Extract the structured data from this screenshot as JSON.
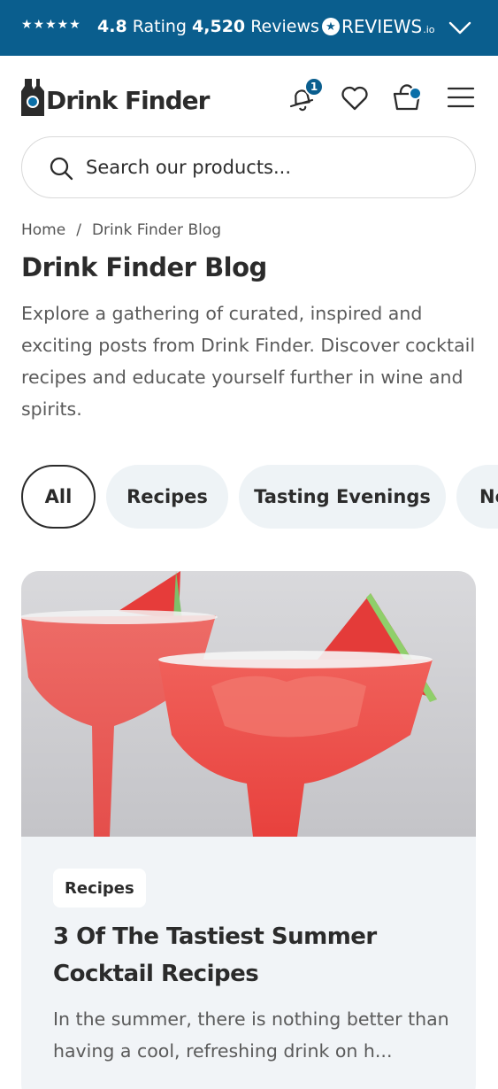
{
  "topbar": {
    "stars": "★★★★★",
    "rating_value": "4.8",
    "rating_label": "Rating",
    "review_count": "4,520",
    "reviews_label": "Reviews",
    "provider": "REVIEWS",
    "provider_suffix": ".io",
    "background": "#0a5e8e"
  },
  "header": {
    "brand": "Drink Finder",
    "notification_count": "1",
    "icons": [
      "bell-icon",
      "heart-icon",
      "basket-icon",
      "menu-icon"
    ]
  },
  "search": {
    "placeholder": "Search our products..."
  },
  "breadcrumb": {
    "items": [
      "Home",
      "Drink Finder Blog"
    ],
    "separator": "/"
  },
  "page": {
    "title": "Drink Finder Blog",
    "intro": "Explore a gathering of curated, inspired and exciting posts from Drink Finder. Discover cocktail recipes and educate yourself further in wine and spirits."
  },
  "filters": {
    "chips": [
      "All",
      "Recipes",
      "Tasting Evenings",
      "Ne"
    ],
    "active": "All"
  },
  "card": {
    "tag": "Recipes",
    "title": "3 Of The Tastiest Summer Cocktail Recipes",
    "excerpt": "In the summer, there is nothing better than having a cool, refreshing drink on h..."
  },
  "colors": {
    "accent": "#0a5e8e",
    "chip_bg": "#eef3f6",
    "card_bg": "#f1f4f7"
  }
}
